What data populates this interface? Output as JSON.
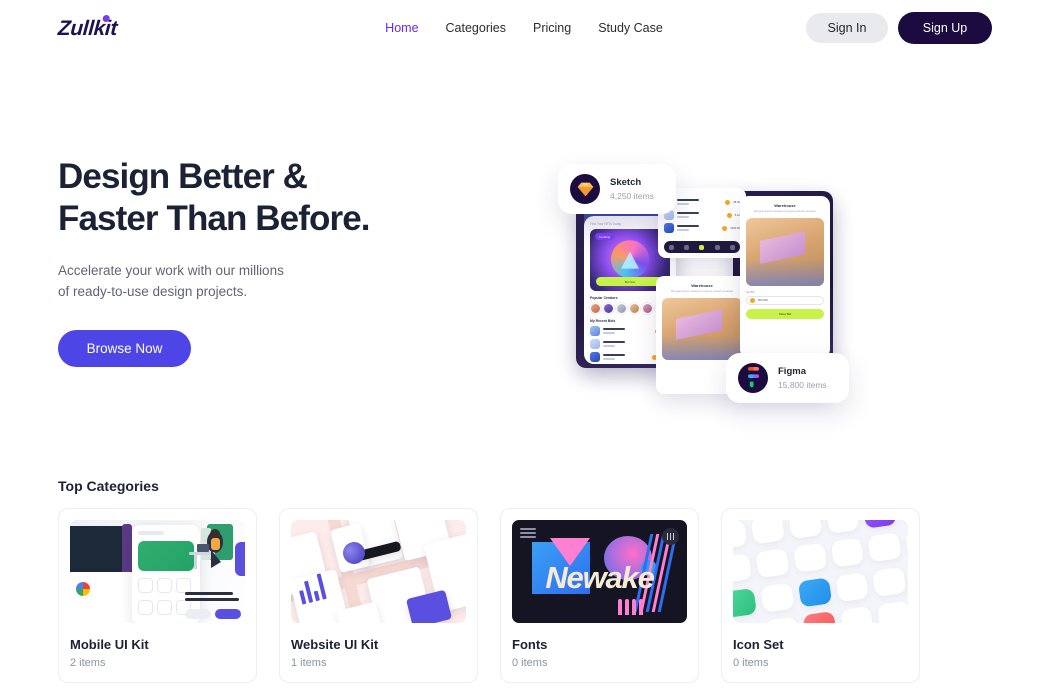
{
  "brand": {
    "name": "Zullkit",
    "logo_dot_color": "#7c3aed",
    "text_color": "#1e1250"
  },
  "nav": {
    "items": [
      {
        "label": "Home",
        "active": true
      },
      {
        "label": "Categories",
        "active": false
      },
      {
        "label": "Pricing",
        "active": false
      },
      {
        "label": "Study Case",
        "active": false
      }
    ]
  },
  "auth": {
    "sign_in_label": "Sign In",
    "sign_up_label": "Sign Up",
    "sign_in_bg": "#e9eaee",
    "sign_up_bg": "#1c0b3f"
  },
  "hero": {
    "title_line1": "Design Better &",
    "title_line2": "Faster Than Before.",
    "subtitle_line1": "Accelerate your work with our millions",
    "subtitle_line2": "of ready-to-use design projects.",
    "cta_label": "Browse Now",
    "cta_color": "#4d45e6",
    "chips": [
      {
        "name": "Sketch",
        "meta": "4,250 items",
        "icon": "sketch-diamond-icon"
      },
      {
        "name": "Figma",
        "meta": "15,800 items",
        "icon": "figma-logo-icon"
      }
    ],
    "mockup_labels": {
      "nft_header": "Find Your NFTs Today",
      "nft_badge": "Trending",
      "nft_bid": "Bid Now",
      "creators": "Popular Creators",
      "recent": "My Recent Bids",
      "warehouse_title": "Warehouse",
      "warehouse_sub": "Menggambarkan betapa pentingnya sebuah penataan",
      "bid_label": "Set Bid",
      "bid_value": "500.000",
      "place_bid": "Place Bid",
      "items": [
        {
          "title": "Dark Colibre",
          "sub": "Vol 12",
          "price": "28.40"
        },
        {
          "title": "Django Icon",
          "sub": "Vol 08",
          "price": "5.10"
        },
        {
          "title": "Dark Colibre",
          "sub": "Vol 03",
          "price": "1250.00"
        }
      ]
    }
  },
  "categories": {
    "heading": "Top Categories",
    "cards": [
      {
        "name": "Mobile UI Kit",
        "count": "2 items",
        "thumb": "dashboard-mockup-thumb"
      },
      {
        "name": "Website UI Kit",
        "count": "1 items",
        "thumb": "web-screens-thumb"
      },
      {
        "name": "Fonts",
        "count": "0 items",
        "thumb": "newake-poster-thumb",
        "poster_word": "Newake"
      },
      {
        "name": "Icon Set",
        "count": "0 items",
        "thumb": "icon-grid-thumb"
      }
    ]
  }
}
